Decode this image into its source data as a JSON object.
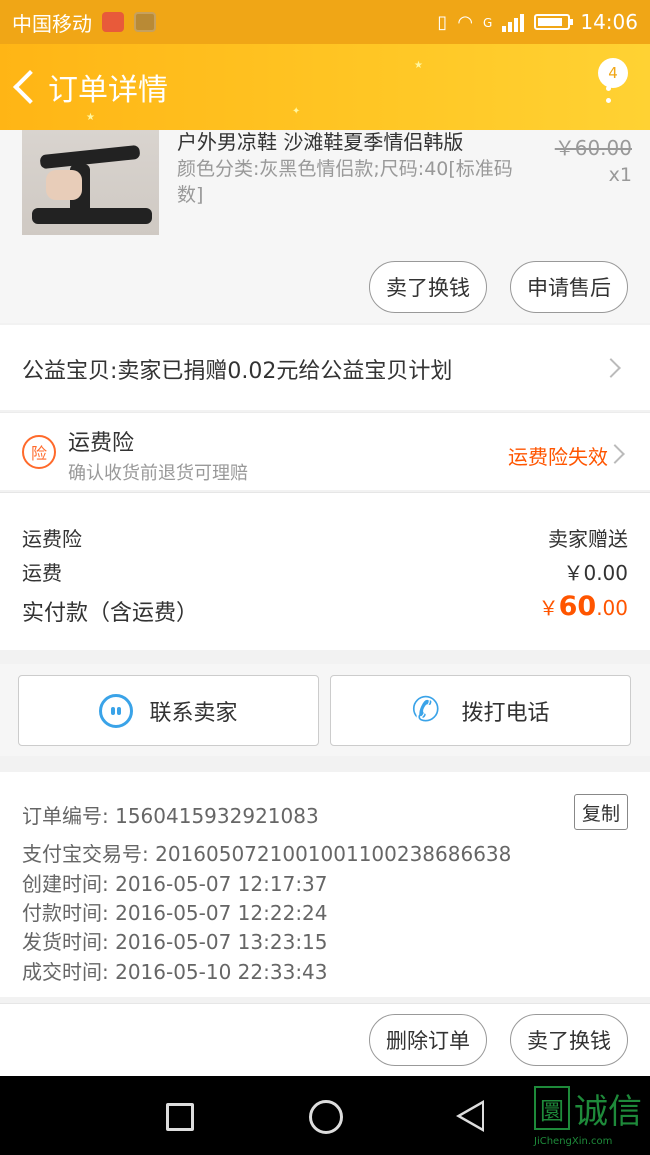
{
  "status_bar": {
    "carrier": "中国移动",
    "network": "G",
    "time": "14:06",
    "battery_level": 0.7
  },
  "header": {
    "title": "订单详情",
    "badge_count": "4"
  },
  "product": {
    "name": "户外男凉鞋 沙滩鞋夏季情侣韩版",
    "sku": "颜色分类:灰黑色情侣款;尺码:40[标准码数]",
    "price": "￥60.00",
    "quantity": "x1",
    "buttons": {
      "sell_swap": "卖了换钱",
      "after_sales": "申请售后"
    }
  },
  "charity": {
    "text": "公益宝贝:卖家已捐赠0.02元给公益宝贝计划"
  },
  "insurance": {
    "icon_char": "险",
    "title": "运费险",
    "subtitle": "确认收货前退货可理赔",
    "status": "运费险失效"
  },
  "fees": {
    "insurance_label": "运费险",
    "insurance_value": "卖家赠送",
    "shipping_label": "运费",
    "shipping_value": "￥0.00",
    "total_label": "实付款（含运费）",
    "total_currency": "￥",
    "total_int": "60",
    "total_dec": ".00"
  },
  "contact": {
    "seller": "联系卖家",
    "call": "拨打电话"
  },
  "order_info": {
    "order_no": "订单编号: 1560415932921083",
    "copy": "复制",
    "alipay_no": "支付宝交易号: 2016050721001001100238686638",
    "created": "创建时间: 2016-05-07 12:17:37",
    "paid": "付款时间: 2016-05-07 12:22:24",
    "shipped": "发货时间: 2016-05-07 13:23:15",
    "completed": "成交时间: 2016-05-10 22:33:43"
  },
  "actions": {
    "delete": "删除订单",
    "sell_swap": "卖了换钱"
  },
  "watermark": {
    "logo": "圜",
    "text": "诚信",
    "url": "JiChengXin.com"
  },
  "colors": {
    "accent": "#ffb515",
    "price_red": "#ff5500",
    "icon_blue": "#3aa3e8"
  }
}
